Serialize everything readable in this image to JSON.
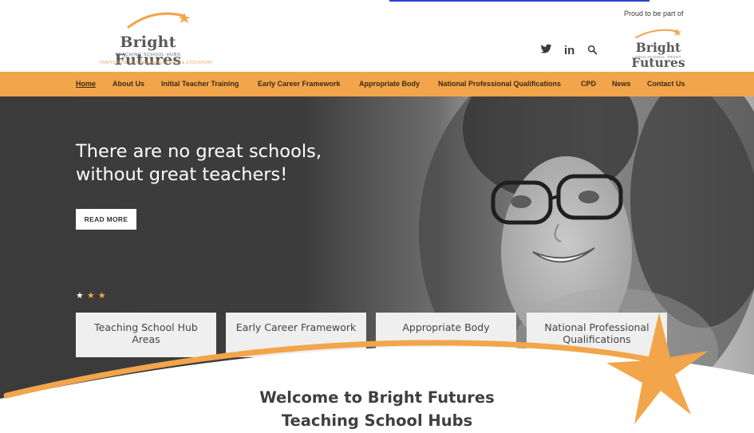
{
  "header": {
    "logo": {
      "title": "Bright Futures",
      "subtitle": "TEACHING SCHOOL HUBS",
      "areas": "TRAFFORD & SALFORD    MANCHESTER & STOCKPORT"
    },
    "social_icons": [
      "twitter-icon",
      "linkedin-icon",
      "search-icon"
    ],
    "proud_text": "Proud to be part of",
    "trust_logo": {
      "title": "Bright Futures",
      "subtitle": "EDUCATIONAL TRUST"
    }
  },
  "nav": {
    "items": [
      {
        "label": "Home",
        "active": true
      },
      {
        "label": "About Us"
      },
      {
        "label": "Initial Teacher Training"
      },
      {
        "label": "Early Career Framework"
      },
      {
        "label": "Appropriate Body"
      },
      {
        "label": "National Professional Qualifications"
      },
      {
        "label": "CPD"
      },
      {
        "label": "News"
      },
      {
        "label": "Contact Us"
      }
    ]
  },
  "hero": {
    "headline_line1": "There are no great schools,",
    "headline_line2": "without great teachers!",
    "cta": "READ MORE"
  },
  "cards": [
    {
      "line1": "Teaching School Hub",
      "line2": "Areas"
    },
    {
      "line1": "Early Career Framework",
      "line2": ""
    },
    {
      "line1": "Appropriate Body",
      "line2": ""
    },
    {
      "line1": "National Professional",
      "line2": "Qualifications"
    }
  ],
  "welcome": {
    "line1": "Welcome to Bright Futures",
    "line2": "Teaching School Hubs"
  },
  "colors": {
    "brand_orange": "#f2a54a",
    "nav_text": "#3b2a15",
    "hero_dark": "#3b3b3b"
  }
}
